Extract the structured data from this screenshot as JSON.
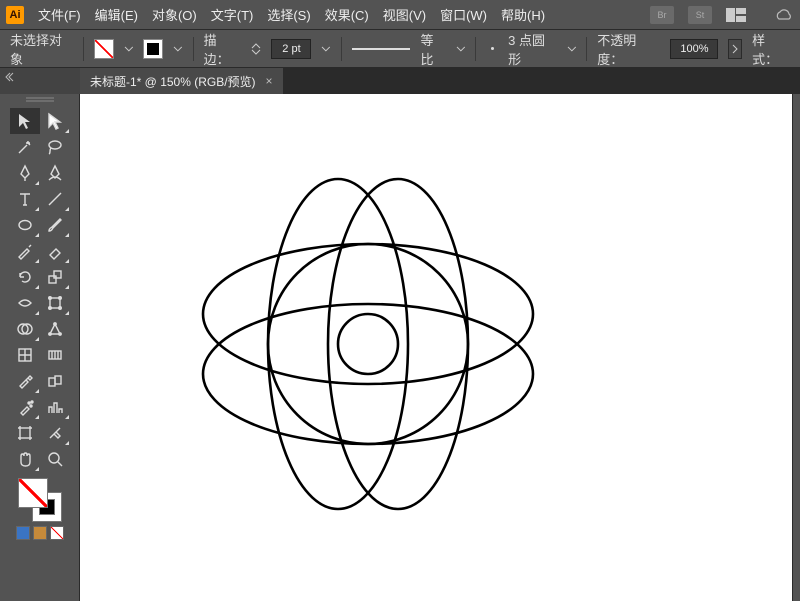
{
  "app": {
    "logo_text": "Ai"
  },
  "menu": {
    "items": [
      "文件(F)",
      "编辑(E)",
      "对象(O)",
      "文字(T)",
      "选择(S)",
      "效果(C)",
      "视图(V)",
      "窗口(W)",
      "帮助(H)"
    ],
    "right_boxes": [
      "Br",
      "St"
    ]
  },
  "control": {
    "selection_status": "未选择对象",
    "stroke_label": "描边：",
    "stroke_weight": "2 pt",
    "profile_label": "等比",
    "brush_label": "3 点圆形",
    "opacity_label": "不透明度：",
    "opacity_value": "100%",
    "style_label": "样式："
  },
  "tab": {
    "title": "未标题-1* @ 150% (RGB/预览)"
  },
  "tools": {
    "names": [
      [
        "selection",
        "direct-selection"
      ],
      [
        "magic-wand",
        "lasso"
      ],
      [
        "pen",
        "curvature"
      ],
      [
        "type",
        "line-segment"
      ],
      [
        "ellipse",
        "paintbrush"
      ],
      [
        "shaper",
        "eraser"
      ],
      [
        "rotate",
        "scale"
      ],
      [
        "width",
        "free-transform"
      ],
      [
        "shape-builder",
        "puppet-warp"
      ],
      [
        "mesh",
        "gradient"
      ],
      [
        "eyedropper",
        "blend"
      ],
      [
        "symbol-sprayer",
        "column-graph"
      ],
      [
        "artboard",
        "slice"
      ],
      [
        "hand",
        "zoom"
      ]
    ]
  },
  "colors": {
    "accent": "#ff9a00",
    "panel": "#535353",
    "panel_dark": "#383838"
  }
}
